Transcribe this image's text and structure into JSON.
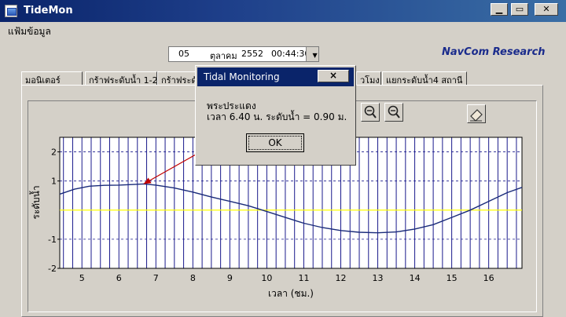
{
  "app": {
    "title": "TideMon"
  },
  "menu": {
    "file": "แฟ้มข้อมูล"
  },
  "datetime": {
    "day": "05",
    "month": "ตุลาคม",
    "year": "2552",
    "time": "00:44:30"
  },
  "brand": "NavCom Research",
  "tabs": [
    {
      "label": "มอนิเตอร์"
    },
    {
      "label": "กร้าฟระดับน้ำ 1-2"
    },
    {
      "label": "กร้าฟระดับ"
    },
    {
      "label": "วโมง"
    },
    {
      "label": "แยกระดับน้ำ4 สถานี"
    }
  ],
  "dialog": {
    "title": "Tidal Monitoring",
    "close_label": "×",
    "station": "พระประแดง",
    "message": "เวลา 6.40 น. ระดับน้ำ =  0.90 ม.",
    "ok_label": "OK"
  },
  "colors": {
    "titlebar": "#0a246a",
    "grid": "#1a1a8c",
    "series": "#1a2b7a",
    "baseline": "#ffff00",
    "arrow": "#c00000"
  },
  "icons": {
    "zoom_in": "zoom-in-icon",
    "zoom_out": "zoom-out-icon",
    "eraser": "eraser-icon"
  },
  "chart_data": {
    "type": "line",
    "xlabel": "เวลา (ชม.)",
    "ylabel": "ระดับน้ำ",
    "xlim": [
      4.4,
      16.9
    ],
    "ylim": [
      -2,
      2.5
    ],
    "xticks": [
      5,
      6,
      7,
      8,
      9,
      10,
      11,
      12,
      13,
      14,
      15,
      16
    ],
    "yticks": [
      2,
      1,
      -1,
      -2
    ],
    "grid": true,
    "baseline_y": 0,
    "highlight": {
      "x": 6.67,
      "y": 0.9
    },
    "series": [
      {
        "x": [
          4.4,
          4.8,
          5.2,
          5.6,
          6.0,
          6.4,
          6.67,
          7.0,
          7.5,
          8.0,
          8.5,
          9.0,
          9.5,
          10.0,
          10.5,
          11.0,
          11.5,
          12.0,
          12.5,
          13.0,
          13.5,
          14.0,
          14.5,
          15.0,
          15.5,
          16.0,
          16.5,
          16.9
        ],
        "y": [
          0.55,
          0.72,
          0.82,
          0.85,
          0.86,
          0.88,
          0.9,
          0.86,
          0.76,
          0.62,
          0.45,
          0.3,
          0.15,
          -0.05,
          -0.25,
          -0.45,
          -0.6,
          -0.7,
          -0.76,
          -0.78,
          -0.75,
          -0.65,
          -0.5,
          -0.25,
          0.0,
          0.3,
          0.6,
          0.78
        ]
      }
    ]
  }
}
